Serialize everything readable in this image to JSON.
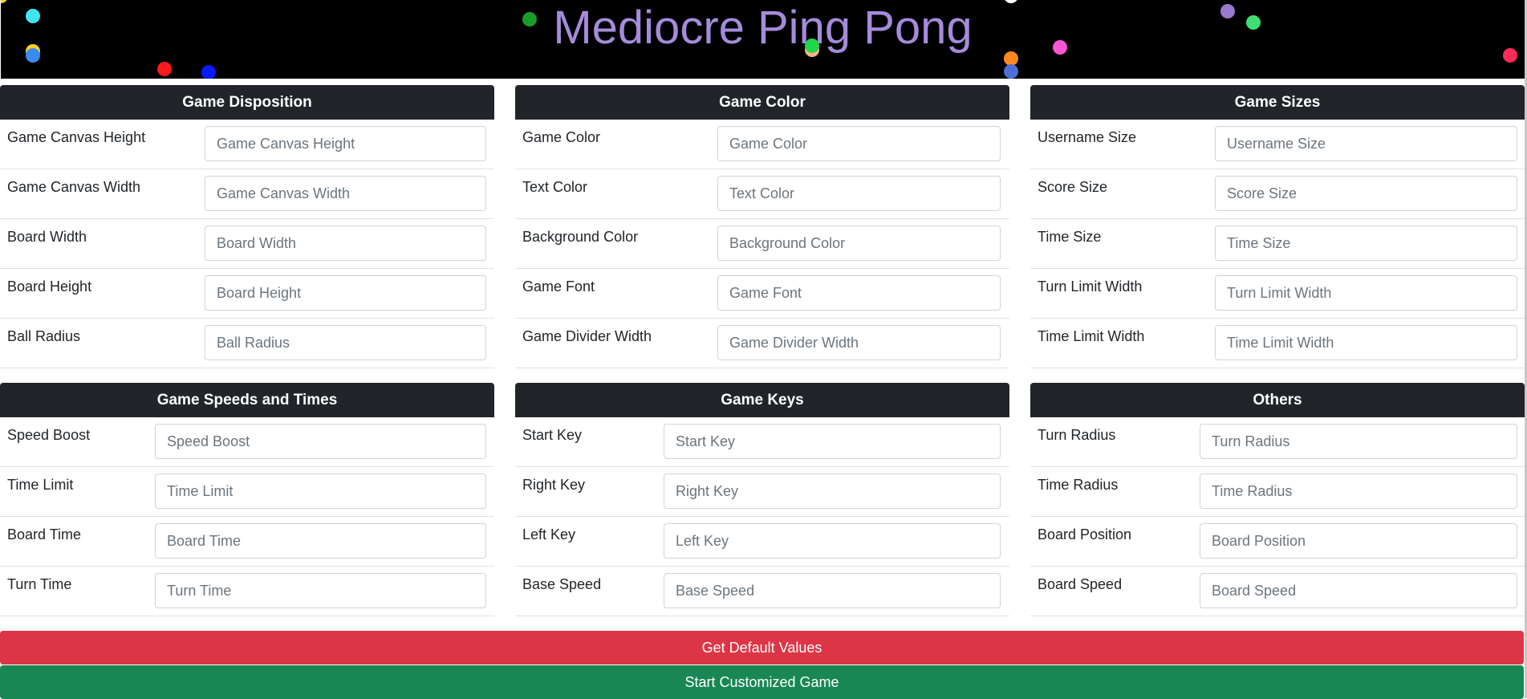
{
  "header": {
    "title": "Mediocre Ping Pong",
    "title_color": "#a58bdb",
    "background": "#000000",
    "ball_colors": [
      "#ffd21f",
      "#3ee6f0",
      "#ffd21f",
      "#3a8bf0",
      "#ff1a1a",
      "#0a19ff",
      "#1a9e2a",
      "#22d64a",
      "#ffb38a",
      "#ffffff",
      "#ff8a1f",
      "#4e6fd8",
      "#ff55d6",
      "#9a7ad0",
      "#3ede72",
      "#ff2d55"
    ]
  },
  "panels": {
    "disposition": {
      "title": "Game Disposition",
      "rows": [
        {
          "label": "Game Canvas Height",
          "placeholder": "Game Canvas Height"
        },
        {
          "label": "Game Canvas Width",
          "placeholder": "Game Canvas Width"
        },
        {
          "label": "Board Width",
          "placeholder": "Board Width"
        },
        {
          "label": "Board Height",
          "placeholder": "Board Height"
        },
        {
          "label": "Ball Radius",
          "placeholder": "Ball Radius"
        }
      ]
    },
    "color": {
      "title": "Game Color",
      "rows": [
        {
          "label": "Game Color",
          "placeholder": "Game Color"
        },
        {
          "label": "Text Color",
          "placeholder": "Text Color"
        },
        {
          "label": "Background Color",
          "placeholder": "Background Color"
        },
        {
          "label": "Game Font",
          "placeholder": "Game Font"
        },
        {
          "label": "Game Divider Width",
          "placeholder": "Game Divider Width"
        }
      ]
    },
    "sizes": {
      "title": "Game Sizes",
      "rows": [
        {
          "label": "Username Size",
          "placeholder": "Username Size"
        },
        {
          "label": "Score Size",
          "placeholder": "Score Size"
        },
        {
          "label": "Time Size",
          "placeholder": "Time Size"
        },
        {
          "label": "Turn Limit Width",
          "placeholder": "Turn Limit Width"
        },
        {
          "label": "Time Limit Width",
          "placeholder": "Time Limit Width"
        }
      ]
    },
    "speeds": {
      "title": "Game Speeds and Times",
      "rows": [
        {
          "label": "Speed Boost",
          "placeholder": "Speed Boost"
        },
        {
          "label": "Time Limit",
          "placeholder": "Time Limit"
        },
        {
          "label": "Board Time",
          "placeholder": "Board Time"
        },
        {
          "label": "Turn Time",
          "placeholder": "Turn Time"
        }
      ]
    },
    "keys": {
      "title": "Game Keys",
      "rows": [
        {
          "label": "Start Key",
          "placeholder": "Start Key"
        },
        {
          "label": "Right Key",
          "placeholder": "Right Key"
        },
        {
          "label": "Left Key",
          "placeholder": "Left Key"
        },
        {
          "label": "Base Speed",
          "placeholder": "Base Speed"
        }
      ]
    },
    "others": {
      "title": "Others",
      "rows": [
        {
          "label": "Turn Radius",
          "placeholder": "Turn Radius"
        },
        {
          "label": "Time Radius",
          "placeholder": "Time Radius"
        },
        {
          "label": "Board Position",
          "placeholder": "Board Position"
        },
        {
          "label": "Board Speed",
          "placeholder": "Board Speed"
        }
      ]
    }
  },
  "buttons": {
    "default_label": "Get Default Values",
    "default_color": "#dc3545",
    "start_label": "Start Customized Game",
    "start_color": "#198754"
  }
}
